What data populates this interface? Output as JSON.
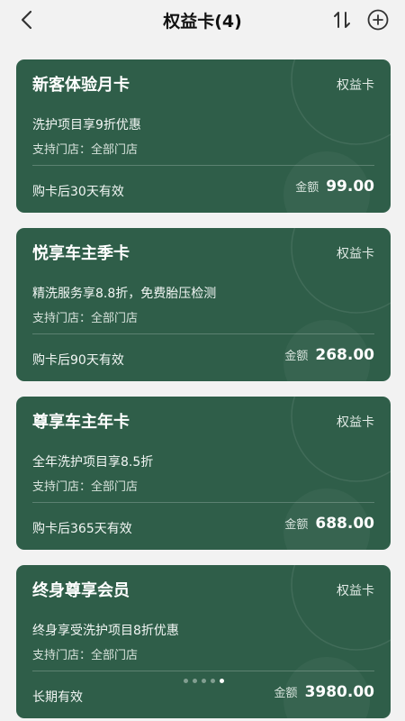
{
  "header": {
    "title": "权益卡(4)",
    "back_icon": "chevron-left-icon",
    "sort_icon": "sort-icon",
    "add_icon": "plus-circle-icon"
  },
  "colors": {
    "card_background": "#2f5e49",
    "page_background": "#f2f2f2"
  },
  "cards": [
    {
      "name": "新客体验月卡",
      "type": "权益卡",
      "description": "洗护项目享9折优惠",
      "store": "支持门店：全部门店",
      "validity": "购卡后30天有效",
      "amount_label": "金额",
      "amount": "99.00"
    },
    {
      "name": "悦享车主季卡",
      "type": "权益卡",
      "description": "精洗服务享8.8折，免费胎压检测",
      "store": "支持门店：全部门店",
      "validity": "购卡后90天有效",
      "amount_label": "金额",
      "amount": "268.00"
    },
    {
      "name": "尊享车主年卡",
      "type": "权益卡",
      "description": "全年洗护项目享8.5折",
      "store": "支持门店：全部门店",
      "validity": "购卡后365天有效",
      "amount_label": "金额",
      "amount": "688.00"
    },
    {
      "name": "终身尊享会员",
      "type": "权益卡",
      "description": "终身享受洗护项目8折优惠",
      "store": "支持门店：全部门店",
      "validity": "长期有效",
      "amount_label": "金额",
      "amount": "3980.00"
    }
  ],
  "pagination": {
    "total": 5,
    "active_index": 5
  }
}
